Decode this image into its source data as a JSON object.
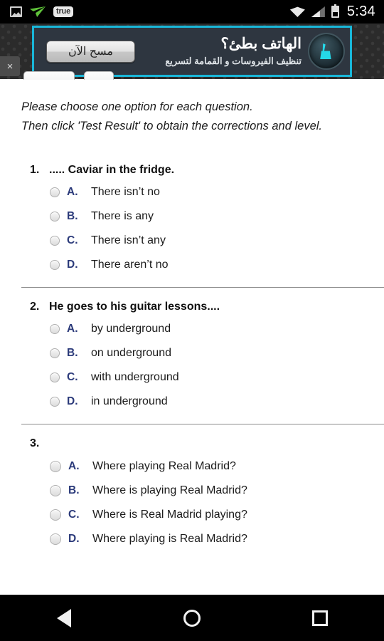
{
  "statusbar": {
    "time": "5:34",
    "left_icons": [
      {
        "name": "screenshot-icon",
        "label": ""
      },
      {
        "name": "paper-plane-icon",
        "label": ""
      },
      {
        "name": "true-badge-icon",
        "label": "true"
      }
    ],
    "right_icons": [
      {
        "name": "wifi-icon"
      },
      {
        "name": "cellular-signal-icon"
      },
      {
        "name": "battery-icon"
      }
    ]
  },
  "ad": {
    "close_label": "×",
    "cta_label": "مسح الآن",
    "headline": "الهاتف بطئ؟",
    "subtext": "تنظيف الفيروسات و القمامة لتسريع",
    "border_color": "#19b7d9",
    "background_color": "#2e3640",
    "icon_name": "broom-cleaner-icon"
  },
  "intro": {
    "line1": "Please choose one option for each question.",
    "line2": "Then click 'Test Result' to obtain the corrections and level."
  },
  "questions": [
    {
      "number": "1.",
      "text": "..... Caviar in the fridge.",
      "options": [
        {
          "letter": "A.",
          "text": "There isn’t no",
          "selected": false
        },
        {
          "letter": "B.",
          "text": "There is any",
          "selected": false
        },
        {
          "letter": "C.",
          "text": "There isn’t any",
          "selected": false
        },
        {
          "letter": "D.",
          "text": "There aren’t no",
          "selected": false
        }
      ]
    },
    {
      "number": "2.",
      "text": "He goes to his guitar lessons....",
      "options": [
        {
          "letter": "A.",
          "text": "by underground",
          "selected": false
        },
        {
          "letter": "B.",
          "text": "on underground",
          "selected": false
        },
        {
          "letter": "C.",
          "text": "with underground",
          "selected": false
        },
        {
          "letter": "D.",
          "text": "in underground",
          "selected": false
        }
      ]
    },
    {
      "number": "3.",
      "text": "",
      "options": [
        {
          "letter": "A.",
          "text": "Where playing Real Madrid?",
          "selected": false
        },
        {
          "letter": "B.",
          "text": "Where is playing Real Madrid?",
          "selected": false
        },
        {
          "letter": "C.",
          "text": "Where is Real Madrid playing?",
          "selected": false
        },
        {
          "letter": "D.",
          "text": "Where playing is Real Madrid?",
          "selected": false
        }
      ]
    }
  ],
  "navbar": {
    "back_label": "back-icon",
    "home_label": "home-icon",
    "recents_label": "recents-icon"
  },
  "colors": {
    "option_letter": "#2b3a7a",
    "accent": "#19b7d9",
    "divider": "#8c8c8c"
  }
}
